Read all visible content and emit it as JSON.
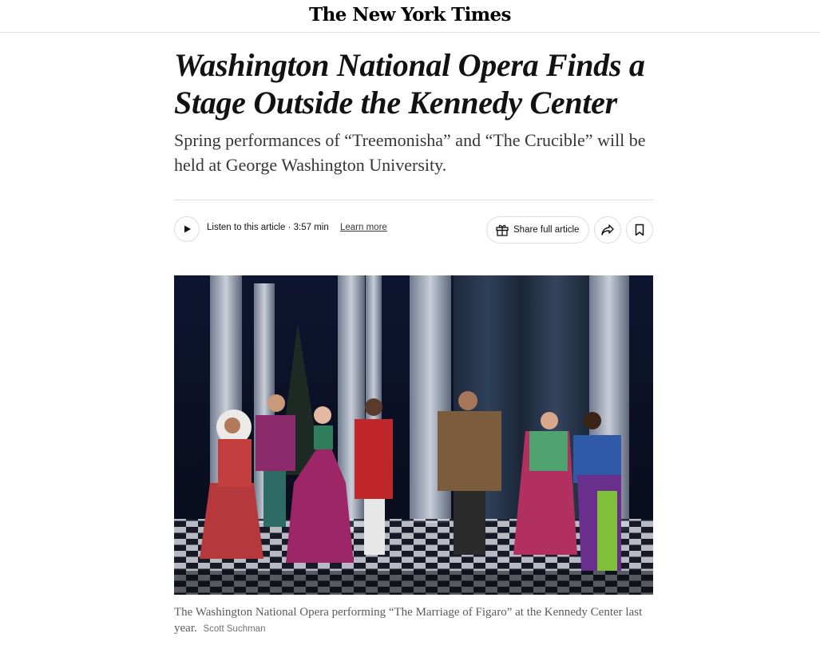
{
  "masthead": {
    "logo": "The New York Times"
  },
  "article": {
    "headline": "Washington National Opera Finds a Stage Outside the Kennedy Center",
    "summary": "Spring performances of “Treemonisha” and “The Crucible” will be held at George Washington University."
  },
  "toolbar": {
    "play_icon": "play-icon",
    "listen_text": "Listen to this article · 3:57 min",
    "learn_more": "Learn more",
    "share_label": "Share full article",
    "gift_icon": "gift-icon",
    "forward_icon": "share-arrow-icon",
    "bookmark_icon": "bookmark-icon"
  },
  "photo": {
    "caption": "The Washington National Opera performing “The Marriage of Figaro” at the Kennedy Center last year.",
    "credit": "Scott Suchman"
  }
}
